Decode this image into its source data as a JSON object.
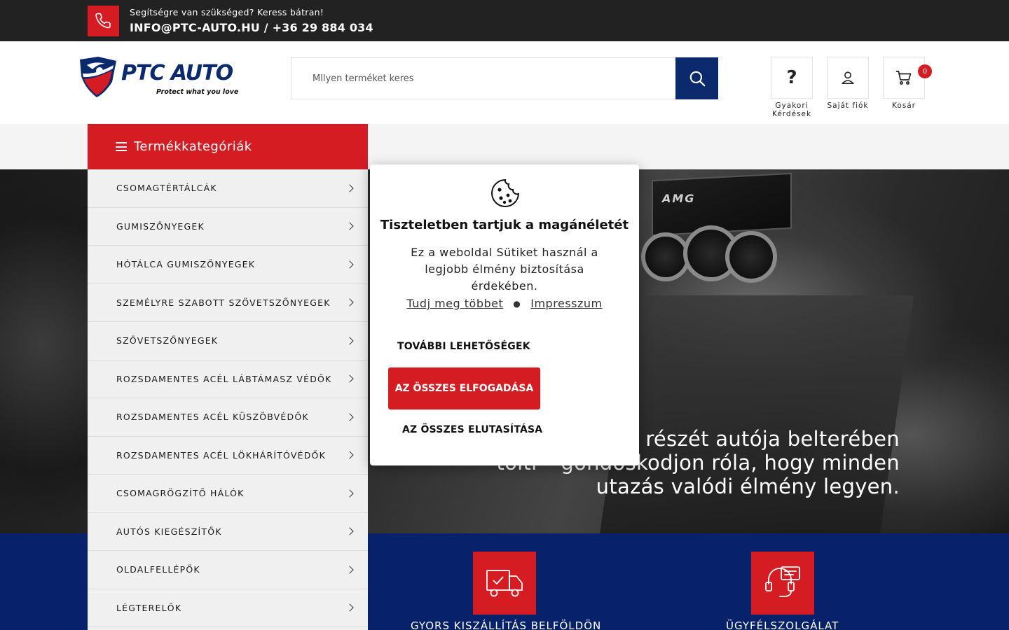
{
  "topbar": {
    "help_text": "Segítségre van szükséged? Keress bátran!",
    "email": "INFO@PTC-AUTO.HU",
    "separator": " / ",
    "phone": "+36 29 884 034"
  },
  "logo": {
    "brand": "PTC AUTO",
    "tagline": "Protect what you love"
  },
  "search": {
    "placeholder": "Mllyen terméket keres"
  },
  "header_icons": {
    "faq_glyph": "?",
    "faq_label": "Gyakori Kérdések",
    "account_label": "Saját fiók",
    "cart_label": "Kosár",
    "cart_count": "0"
  },
  "categories": {
    "title": "Termékkategóriák",
    "items": [
      "CSOMAGTÉRTÁLCÁK",
      "GUMISZŐNYEGEK",
      "HÓTÁLCA GUMISZŐNYEGEK",
      "SZEMÉLYRE SZABOTT SZÖVETSZŐNYEGEK",
      "SZÖVETSZŐNYEGEK",
      "ROZSDAMENTES ACÉL LÁBTÁMASZ VÉDŐK",
      "ROZSDAMENTES ACÉL KÜSZÖBVÉDŐK",
      "ROZSDAMENTES ACÉL LÖKHÁRÍTÓVÉDŐK",
      "CSOMAGRÖGZÍTŐ HÁLÓK",
      "AUTÓS KIEGÉSZÍTŐK",
      "OLDALFELLÉPŐK",
      "LÉGTERELŐK"
    ]
  },
  "hero": {
    "line1": "részét autója belterében",
    "line2": "tölti – gondoskodjon róla, hogy minden",
    "line3": "utazás valódi élmény legyen.",
    "badge_text": "AMG"
  },
  "features": {
    "shipping": "GYORS KISZÁLLÍTÁS BELFÖLDÖN",
    "support": "ÜGYFÉLSZOLGÁLAT"
  },
  "cookie_modal": {
    "title": "Tiszteletben tartjuk a magánéletét",
    "body": "Ez a weboldal Sütiket használ a legjobb élmény biztosítása érdekében.",
    "learn_more": "Tudj meg többet",
    "dot": "●",
    "impressum": "Impresszum",
    "more_options": "TOVÁBBI LEHETŐSÉGEK",
    "accept_all": "AZ ÖSSZES ELFOGADÁSA",
    "reject_all": "AZ ÖSSZES ELUTASÍTÁSA"
  },
  "colors": {
    "brand_red": "#d61c23",
    "brand_blue": "#07226b",
    "topbar_bg": "#222222"
  }
}
